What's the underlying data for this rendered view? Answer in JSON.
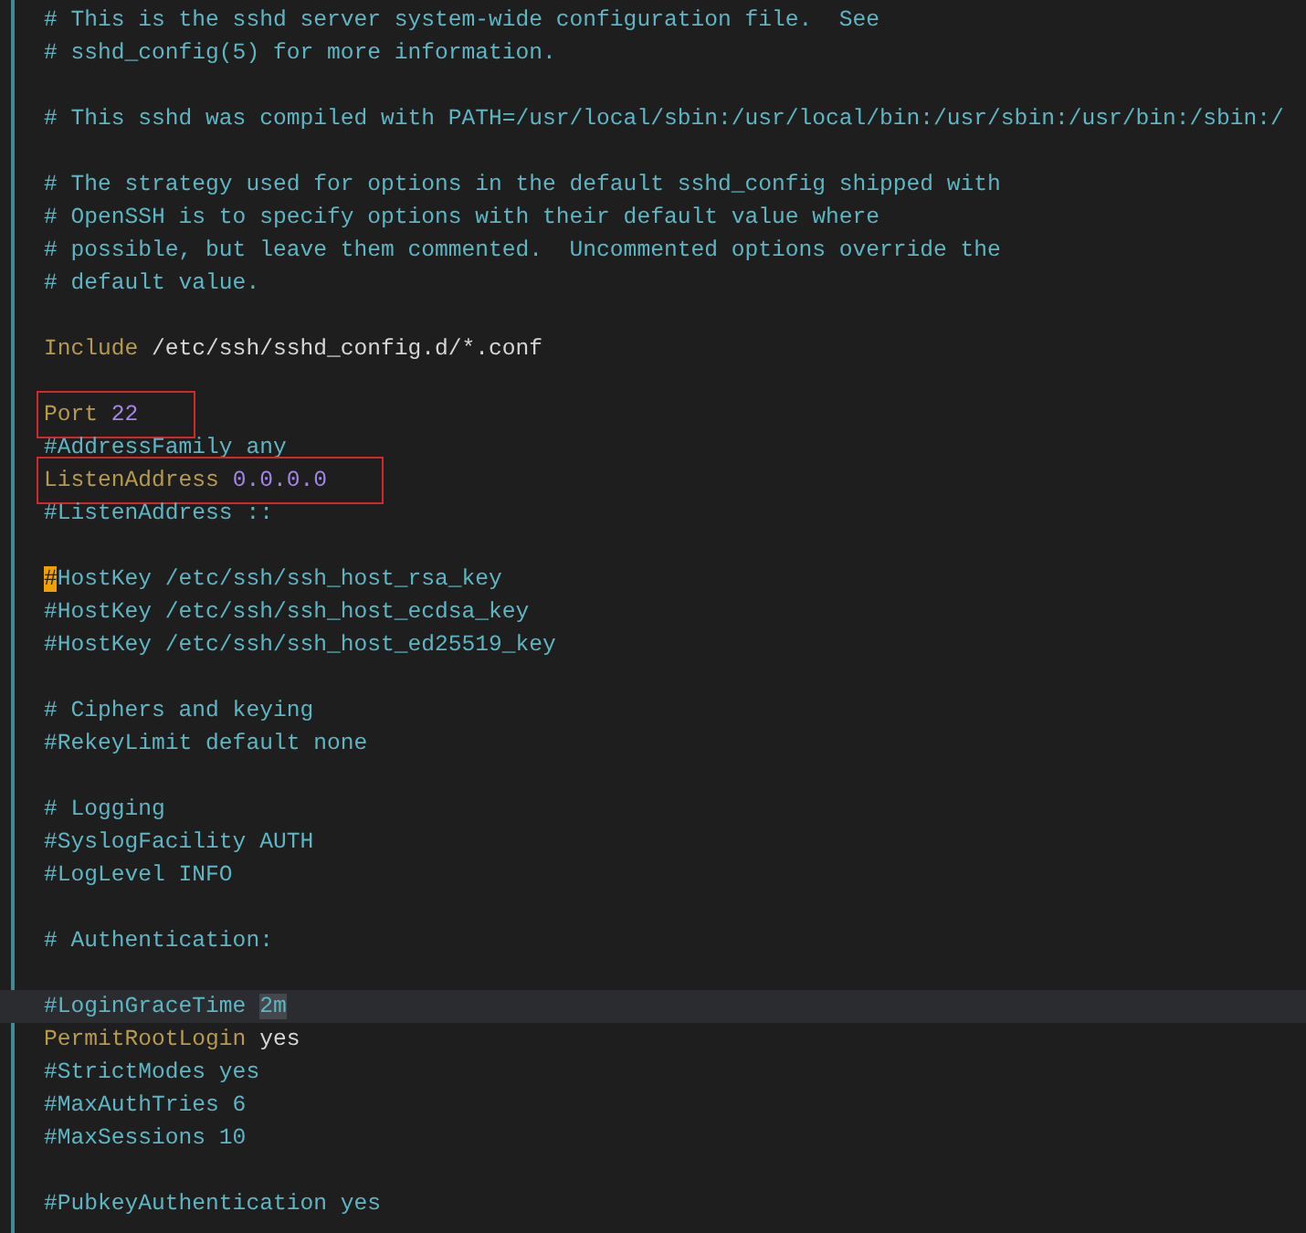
{
  "lines": [
    {
      "kind": "code",
      "segments": [
        {
          "kind": "comment",
          "text": "# This is the sshd server system-wide configuration file.  See"
        }
      ]
    },
    {
      "kind": "code",
      "segments": [
        {
          "kind": "comment",
          "text": "# sshd_config(5) for more information."
        }
      ]
    },
    {
      "kind": "blank"
    },
    {
      "kind": "code",
      "segments": [
        {
          "kind": "comment",
          "text": "# This sshd was compiled with PATH=/usr/local/sbin:/usr/local/bin:/usr/sbin:/usr/bin:/sbin:/"
        }
      ]
    },
    {
      "kind": "blank"
    },
    {
      "kind": "code",
      "segments": [
        {
          "kind": "comment",
          "text": "# The strategy used for options in the default sshd_config shipped with"
        }
      ]
    },
    {
      "kind": "code",
      "segments": [
        {
          "kind": "comment",
          "text": "# OpenSSH is to specify options with their default value where"
        }
      ]
    },
    {
      "kind": "code",
      "segments": [
        {
          "kind": "comment",
          "text": "# possible, but leave them commented.  Uncommented options override the"
        }
      ]
    },
    {
      "kind": "code",
      "segments": [
        {
          "kind": "comment",
          "text": "# default value."
        }
      ]
    },
    {
      "kind": "blank"
    },
    {
      "kind": "code",
      "segments": [
        {
          "kind": "keyword",
          "text": "Include"
        },
        {
          "kind": "plain",
          "text": " /etc/ssh/sshd_config.d/*.conf"
        }
      ]
    },
    {
      "kind": "blank"
    },
    {
      "kind": "code",
      "boxed": true,
      "segments": [
        {
          "kind": "keyword",
          "text": "Port "
        },
        {
          "kind": "number",
          "text": "22"
        }
      ]
    },
    {
      "kind": "code",
      "segments": [
        {
          "kind": "comment",
          "text": "#AddressFamily any"
        }
      ]
    },
    {
      "kind": "code",
      "boxed": true,
      "segments": [
        {
          "kind": "keyword",
          "text": "ListenAddress "
        },
        {
          "kind": "number",
          "text": "0.0.0.0"
        }
      ]
    },
    {
      "kind": "code",
      "segments": [
        {
          "kind": "comment",
          "text": "#ListenAddress ::"
        }
      ]
    },
    {
      "kind": "blank"
    },
    {
      "kind": "code",
      "segments": [
        {
          "kind": "cursor",
          "text": "#"
        },
        {
          "kind": "comment",
          "text": "HostKey /etc/ssh/ssh_host_rsa_key"
        }
      ]
    },
    {
      "kind": "code",
      "segments": [
        {
          "kind": "comment",
          "text": "#HostKey /etc/ssh/ssh_host_ecdsa_key"
        }
      ]
    },
    {
      "kind": "code",
      "segments": [
        {
          "kind": "comment",
          "text": "#HostKey /etc/ssh/ssh_host_ed25519_key"
        }
      ]
    },
    {
      "kind": "blank"
    },
    {
      "kind": "code",
      "segments": [
        {
          "kind": "comment",
          "text": "# Ciphers and keying"
        }
      ]
    },
    {
      "kind": "code",
      "segments": [
        {
          "kind": "comment",
          "text": "#RekeyLimit default none"
        }
      ]
    },
    {
      "kind": "blank"
    },
    {
      "kind": "code",
      "segments": [
        {
          "kind": "comment",
          "text": "# Logging"
        }
      ]
    },
    {
      "kind": "code",
      "segments": [
        {
          "kind": "comment",
          "text": "#SyslogFacility AUTH"
        }
      ]
    },
    {
      "kind": "code",
      "segments": [
        {
          "kind": "comment",
          "text": "#LogLevel INFO"
        }
      ]
    },
    {
      "kind": "blank"
    },
    {
      "kind": "code",
      "segments": [
        {
          "kind": "comment",
          "text": "# Authentication:"
        }
      ]
    },
    {
      "kind": "blank"
    },
    {
      "kind": "code",
      "current": true,
      "segments": [
        {
          "kind": "comment",
          "text": "#LoginGraceTime "
        },
        {
          "kind": "match",
          "text": "2m"
        }
      ]
    },
    {
      "kind": "code",
      "segments": [
        {
          "kind": "keyword",
          "text": "PermitRootLogin"
        },
        {
          "kind": "plain",
          "text": " yes"
        }
      ]
    },
    {
      "kind": "code",
      "segments": [
        {
          "kind": "comment",
          "text": "#StrictModes yes"
        }
      ]
    },
    {
      "kind": "code",
      "segments": [
        {
          "kind": "comment",
          "text": "#MaxAuthTries 6"
        }
      ]
    },
    {
      "kind": "code",
      "segments": [
        {
          "kind": "comment",
          "text": "#MaxSessions 10"
        }
      ]
    },
    {
      "kind": "blank"
    },
    {
      "kind": "code",
      "segments": [
        {
          "kind": "comment",
          "text": "#PubkeyAuthentication yes"
        }
      ]
    }
  ]
}
